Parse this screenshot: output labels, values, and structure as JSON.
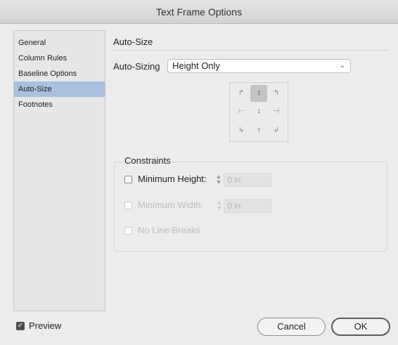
{
  "window": {
    "title": "Text Frame Options"
  },
  "sidebar": {
    "items": [
      {
        "label": "General"
      },
      {
        "label": "Column Rules"
      },
      {
        "label": "Baseline Options"
      },
      {
        "label": "Auto-Size",
        "selected": true
      },
      {
        "label": "Footnotes"
      }
    ]
  },
  "main": {
    "section_title": "Auto-Size",
    "auto_sizing": {
      "label": "Auto-Sizing",
      "value": "Height Only"
    },
    "reference_point": {
      "selected_cell": "top-center",
      "glyphs": {
        "top_left": "↱",
        "top_center": "↕",
        "top_right": "↰",
        "mid_left": "⊢",
        "mid_center": "↕",
        "mid_right": "⊣",
        "bottom_left": "↳",
        "bottom_center": "↑",
        "bottom_right": "↲"
      }
    },
    "constraints": {
      "title": "Constraints",
      "minimum_height": {
        "label": "Minimum Height:",
        "value": "0 in",
        "checked": false,
        "enabled": true
      },
      "minimum_width": {
        "label": "Minimum Width:",
        "value": "0 in",
        "checked": false,
        "enabled": false
      },
      "no_line_breaks": {
        "label": "No Line Breaks",
        "checked": false,
        "enabled": false
      }
    }
  },
  "footer": {
    "preview": {
      "label": "Preview",
      "checked": true
    },
    "cancel_label": "Cancel",
    "ok_label": "OK"
  },
  "colors": {
    "sidebar_selected": "#a9c0de",
    "dialog_bg": "#ececec"
  }
}
